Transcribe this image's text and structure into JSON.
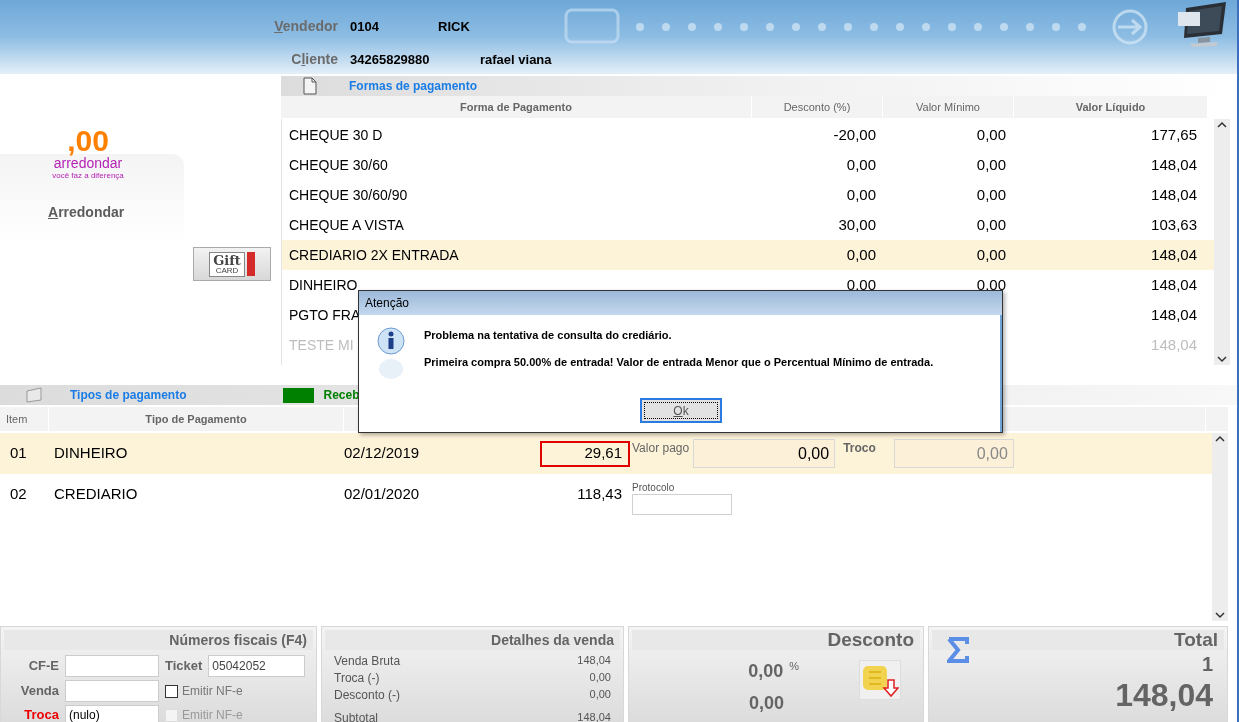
{
  "header": {
    "vendedor_label": "Vendedor",
    "vendedor_code": "0104",
    "vendedor_name": "RICK",
    "cliente_label": "Cliente",
    "cliente_code": "34265829880",
    "cliente_name": "rafael viana"
  },
  "rounding": {
    "logo_value": ",00",
    "logo_name": "arredondar",
    "logo_slogan": "você faz a diferença",
    "button": "Arredondar"
  },
  "gift_card": {
    "label_top": "Gift",
    "label_bottom": "CARD"
  },
  "payment_forms": {
    "title": "Formas de pagamento",
    "columns": [
      {
        "label": "Forma de Pagamento",
        "bold": true
      },
      {
        "label": "Desconto (%)",
        "bold": false
      },
      {
        "label": "Valor Mínimo",
        "bold": false
      },
      {
        "label": "Valor Líquido",
        "bold": true
      }
    ],
    "rows": [
      {
        "forma": "CHEQUE 30 D",
        "desconto": "-20,00",
        "minimo": "0,00",
        "liquido": "177,65",
        "selected": false,
        "disabled": false
      },
      {
        "forma": "CHEQUE 30/60",
        "desconto": "0,00",
        "minimo": "0,00",
        "liquido": "148,04",
        "selected": false,
        "disabled": false
      },
      {
        "forma": "CHEQUE 30/60/90",
        "desconto": "0,00",
        "minimo": "0,00",
        "liquido": "148,04",
        "selected": false,
        "disabled": false
      },
      {
        "forma": "CHEQUE A VISTA",
        "desconto": "30,00",
        "minimo": "0,00",
        "liquido": "103,63",
        "selected": false,
        "disabled": false
      },
      {
        "forma": "CREDIARIO 2X ENTRADA",
        "desconto": "0,00",
        "minimo": "0,00",
        "liquido": "148,04",
        "selected": true,
        "disabled": false
      },
      {
        "forma": "DINHEIRO",
        "desconto": "0,00",
        "minimo": "0,00",
        "liquido": "148,04",
        "selected": false,
        "disabled": false
      },
      {
        "forma": "PGTO FRA",
        "liquido": "148,04",
        "selected": false,
        "disabled": false
      },
      {
        "forma": "TESTE MI",
        "liquido": "148,04",
        "selected": false,
        "disabled": true
      }
    ]
  },
  "payment_types": {
    "title": "Tipos de pagamento",
    "receb_label": "Receb",
    "columns": [
      "Item",
      "Tipo de Pagamento"
    ],
    "rows": [
      {
        "kind": "paid",
        "item": "01",
        "tipo": "DINHEIRO",
        "date": "02/12/2019",
        "value": "29,61",
        "selected": true,
        "flagged": true,
        "paid_label": "Valor pago",
        "paid_value": "0,00",
        "change_label": "Troco",
        "change_value": "0,00"
      },
      {
        "kind": "protocol",
        "item": "02",
        "tipo": "CREDIARIO",
        "date": "02/01/2020",
        "value": "118,43",
        "selected": false,
        "flagged": false,
        "protocol_label": "Protocolo"
      }
    ]
  },
  "fiscal": {
    "title": "Números fiscais (F4)",
    "cfe_label": "CF-E",
    "ticket_label": "Ticket",
    "ticket_value": "05042052",
    "venda_label": "Venda",
    "troca_label": "Troca",
    "troca_alert": true,
    "troca_value": "(nulo)",
    "nfe_options": [
      {
        "label": "Emitir NF-e",
        "checked": false,
        "disabled": false
      },
      {
        "label": "Emitir NF-e",
        "checked": false,
        "disabled": true
      }
    ]
  },
  "details": {
    "title": "Detalhes da venda",
    "lines": [
      {
        "label": "Venda Bruta",
        "value": "148,04"
      },
      {
        "label": "Troca (-)",
        "value": "0,00"
      },
      {
        "label": "Desconto (-)",
        "value": "0,00"
      },
      {
        "label": "Subtotal",
        "value": "148,04"
      }
    ]
  },
  "discount": {
    "title": "Desconto",
    "percent": "0,00",
    "percent_sign": "%",
    "amount": "0,00"
  },
  "total": {
    "title": "Total",
    "count": "1",
    "amount": "148,04"
  },
  "dialog": {
    "title": "Atenção",
    "messages": [
      "Problema na tentativa de consulta do crediário.",
      "Primeira compra 50.00% de entrada! Valor de entrada Menor que o Percentual Mínimo de entrada."
    ],
    "button": "Ok"
  }
}
